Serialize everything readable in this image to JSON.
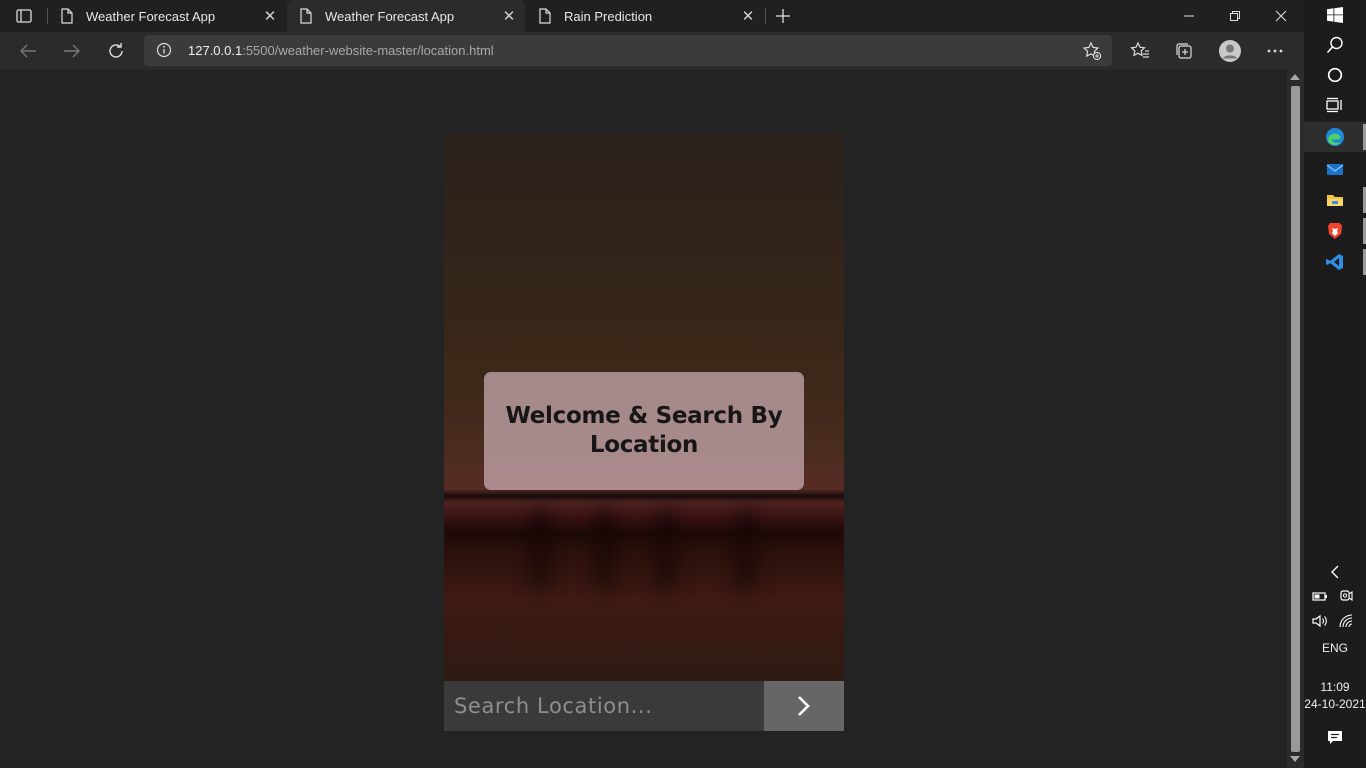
{
  "browser": {
    "tabs": [
      {
        "title": "Weather Forecast App",
        "active": false
      },
      {
        "title": "Weather Forecast App",
        "active": true
      },
      {
        "title": "Rain Prediction",
        "active": false
      }
    ],
    "address": {
      "host": "127.0.0.1",
      "path": ":5500/weather-website-master/location.html"
    }
  },
  "page": {
    "welcome_title": "Welcome & Search By Location",
    "search": {
      "placeholder": "Search Location...",
      "value": ""
    }
  },
  "taskbar": {
    "language": "ENG",
    "time": "11:09",
    "date": "24-10-2021"
  },
  "colors": {
    "accent_edge": "#2b7fd6",
    "vscode": "#2c8ee6",
    "brave": "#f0442c"
  }
}
